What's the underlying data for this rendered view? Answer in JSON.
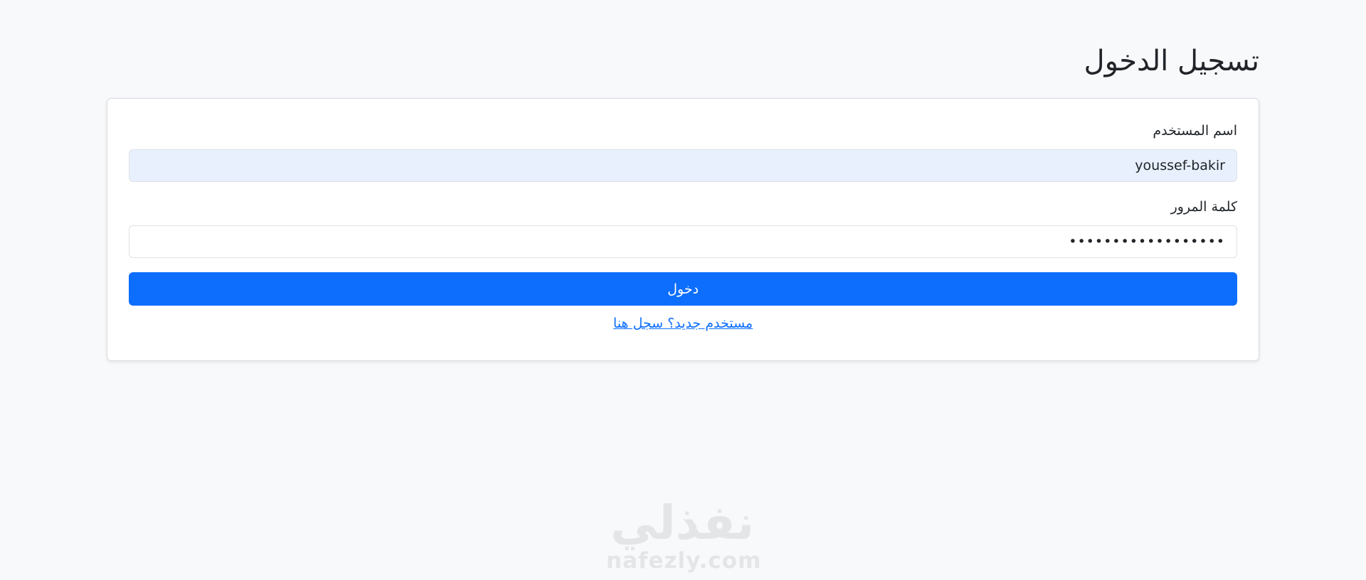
{
  "page": {
    "title": "تسجيل الدخول"
  },
  "form": {
    "username_label": "اسم المستخدم",
    "username_value": "youssef-bakir",
    "password_label": "كلمة المرور",
    "password_value": "••••••••••••••••••",
    "submit_label": "دخول",
    "register_link": "مستخدم جديد؟ سجل هنا"
  },
  "watermark": {
    "logo": "نفذلي",
    "url": "nafezly.com"
  },
  "colors": {
    "background": "#f8f9fa",
    "card": "#ffffff",
    "primary": "#0d6efd",
    "autofill": "#e8f0fe",
    "text": "#212529",
    "watermark": "#e4e5e7"
  }
}
